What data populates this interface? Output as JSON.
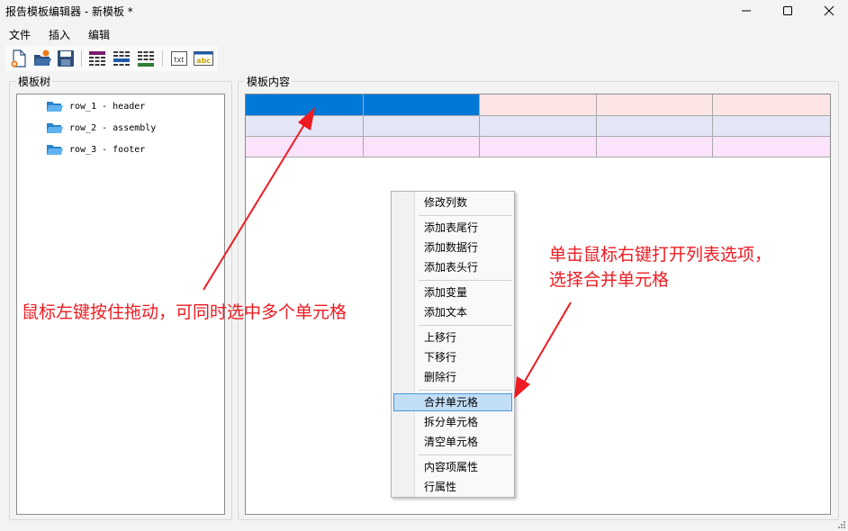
{
  "window": {
    "title": "报告模板编辑器 - 新模板 *"
  },
  "menu": [
    "文件",
    "插入",
    "编辑"
  ],
  "toolbar": {
    "txt_label": "txt",
    "abc_label": "abc"
  },
  "tree": {
    "label": "模板树",
    "items": [
      "row_1 - header",
      "row_2 - assembly",
      "row_3 - footer"
    ]
  },
  "content": {
    "label": "模板内容"
  },
  "context_menu": {
    "groups": [
      [
        "修改列数"
      ],
      [
        "添加表尾行",
        "添加数据行",
        "添加表头行"
      ],
      [
        "添加变量",
        "添加文本"
      ],
      [
        "上移行",
        "下移行",
        "删除行"
      ],
      [
        "合并单元格",
        "拆分单元格",
        "清空单元格"
      ],
      [
        "内容项属性",
        "行属性"
      ]
    ],
    "active_item": "合并单元格"
  },
  "annotations": {
    "left": "鼠标左键按住拖动，可同时选中多个单元格",
    "right_line1": "单击鼠标右键打开列表选项，",
    "right_line2": "选择合并单元格"
  },
  "colors": {
    "selected_cell": "#0078d7",
    "header_row": "#fde5e5",
    "data_row": "#e5e5f8",
    "footer_row": "#fbe3fb",
    "annotation": "#ee1b22",
    "menu_highlight": "#c2ddf6"
  }
}
